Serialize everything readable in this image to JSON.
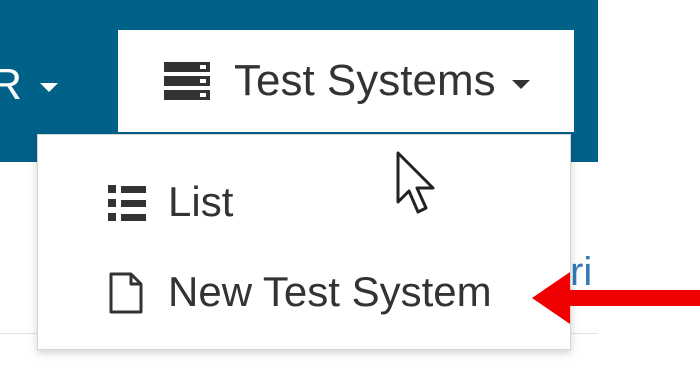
{
  "navbar": {
    "left_partial_label": "R",
    "active_label": "Test Systems",
    "bg_color": "#006289"
  },
  "dropdown": {
    "items": [
      {
        "label": "List",
        "icon": "list-ol-icon"
      },
      {
        "label": "New Test System",
        "icon": "file-icon"
      }
    ]
  },
  "background_partial_text": "ri",
  "annotation": {
    "arrow_color": "#f00000",
    "cursor": "mouse-pointer-icon"
  }
}
